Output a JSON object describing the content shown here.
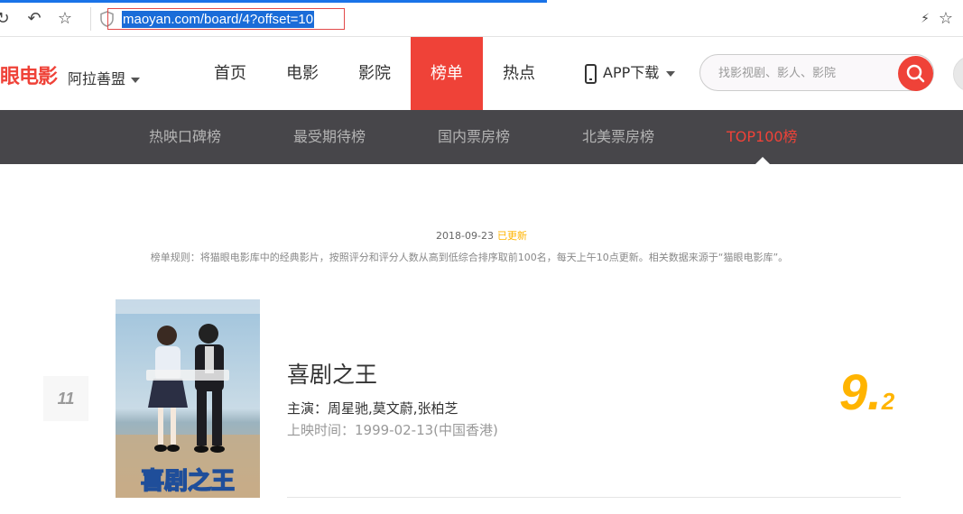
{
  "browser": {
    "url": "maoyan.com/board/4?offset=10"
  },
  "header": {
    "logo_text": "眼电影",
    "city": "阿拉善盟",
    "nav": [
      {
        "label": "首页"
      },
      {
        "label": "电影"
      },
      {
        "label": "影院"
      },
      {
        "label": "榜单",
        "active": true
      },
      {
        "label": "热点"
      }
    ],
    "app_download": "APP下载",
    "search_placeholder": "找影视剧、影人、影院"
  },
  "sub_nav": {
    "items": [
      {
        "label": "热映口碑榜"
      },
      {
        "label": "最受期待榜"
      },
      {
        "label": "国内票房榜"
      },
      {
        "label": "北美票房榜"
      },
      {
        "label": "TOP100榜",
        "active": true
      }
    ]
  },
  "board": {
    "date": "2018-09-23",
    "updated_label": "已更新",
    "rule": "榜单规则：将猫眼电影库中的经典影片，按照评分和评分人数从高到低综合排序取前100名，每天上午10点更新。相关数据来源于“猫眼电影库”。",
    "movies": [
      {
        "rank": "11",
        "title": "喜剧之王",
        "stars": "主演：周星驰,莫文蔚,张柏芝",
        "release": "上映时间：1999-02-13(中国香港)",
        "score_int": "9.",
        "score_frac": "2",
        "poster_text": "喜剧之王"
      }
    ]
  },
  "colors": {
    "brand": "#ef4238",
    "score": "#ffb400",
    "subnav_bg": "#47464a"
  }
}
